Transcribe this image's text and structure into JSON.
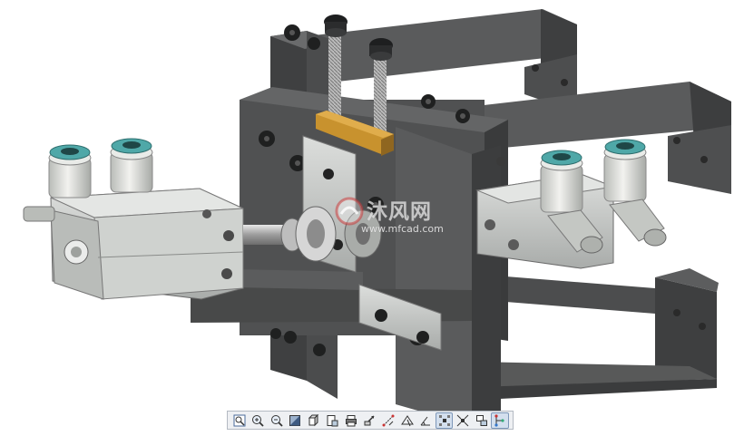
{
  "watermark": {
    "cn_text": "沐风网",
    "url_text": "www.mfcad.com"
  },
  "toolbar": {
    "buttons": [
      {
        "icon": "zoom-fit-icon",
        "active": false
      },
      {
        "icon": "zoom-in-icon",
        "active": false
      },
      {
        "icon": "zoom-out-icon",
        "active": false
      },
      {
        "icon": "shaded-view-icon",
        "active": false
      },
      {
        "icon": "cube-view-icon",
        "active": false
      },
      {
        "icon": "page-view-icon",
        "active": false
      },
      {
        "icon": "print-icon",
        "active": false
      },
      {
        "icon": "export-icon",
        "active": false
      },
      {
        "icon": "measure-icon",
        "active": false
      },
      {
        "icon": "section-icon",
        "active": false
      },
      {
        "icon": "angle-icon",
        "active": false
      },
      {
        "icon": "explode-icon",
        "active": true
      },
      {
        "icon": "explode-alt-icon",
        "active": false
      },
      {
        "icon": "assembly-icon",
        "active": false
      },
      {
        "icon": "tree-icon",
        "active": true
      }
    ]
  },
  "colors": {
    "frame": "#4a4b4c",
    "frame_light": "#5f6061",
    "aluminum": "#c9ccc9",
    "brass": "#c8922e",
    "fitting_teal": "#4fa8a8",
    "background": "#ffffff"
  }
}
